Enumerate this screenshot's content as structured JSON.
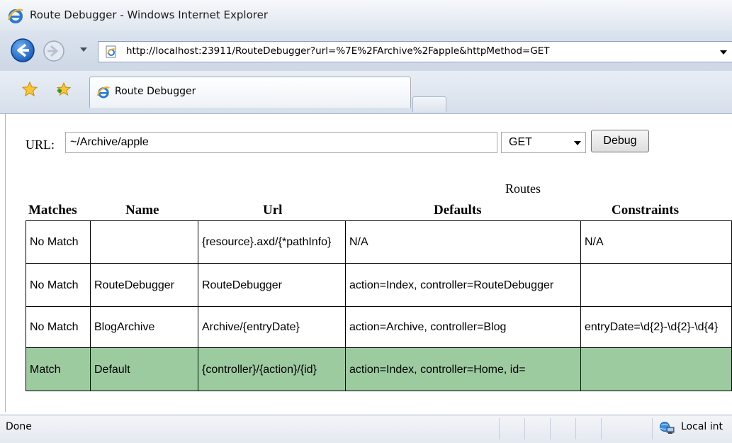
{
  "window": {
    "title": "Route Debugger - Windows Internet Explorer"
  },
  "address_bar": {
    "url": "http://localhost:23911/RouteDebugger?url=%7E%2FArchive%2Fapple&httpMethod=GET"
  },
  "tabs": [
    {
      "label": "Route Debugger",
      "active": true
    }
  ],
  "form": {
    "url_label": "URL:",
    "url_value": "~/Archive/apple",
    "method_value": "GET",
    "debug_label": "Debug"
  },
  "routes": {
    "caption": "Routes",
    "columns": [
      "Matches",
      "Name",
      "Url",
      "Defaults",
      "Constraints"
    ],
    "rows": [
      {
        "matches": "No Match",
        "name": "",
        "url": "{resource}.axd/{*pathInfo}",
        "defaults": "N/A",
        "constraints": "N/A",
        "is_match": false
      },
      {
        "matches": "No Match",
        "name": "RouteDebugger",
        "url": "RouteDebugger",
        "defaults": "action=Index, controller=RouteDebugger",
        "constraints": "",
        "is_match": false
      },
      {
        "matches": "No Match",
        "name": "BlogArchive",
        "url": "Archive/{entryDate}",
        "defaults": "action=Archive, controller=Blog",
        "constraints": "entryDate=\\d{2}-\\d{2}-\\d{4}",
        "is_match": false
      },
      {
        "matches": "Match",
        "name": "Default",
        "url": "{controller}/{action}/{id}",
        "defaults": "action=Index, controller=Home, id=",
        "constraints": "",
        "is_match": true
      }
    ],
    "match_color": "#9bcb9f"
  },
  "status_bar": {
    "text": "Done",
    "zone": "Local int"
  },
  "icons": {
    "title": "ie-logo-icon",
    "back": "back-arrow-icon",
    "forward": "forward-arrow-icon",
    "favorites": "favorites-star-icon",
    "add_favorites": "add-favorites-icon",
    "page": "page-icon",
    "zone": "local-intranet-icon"
  }
}
